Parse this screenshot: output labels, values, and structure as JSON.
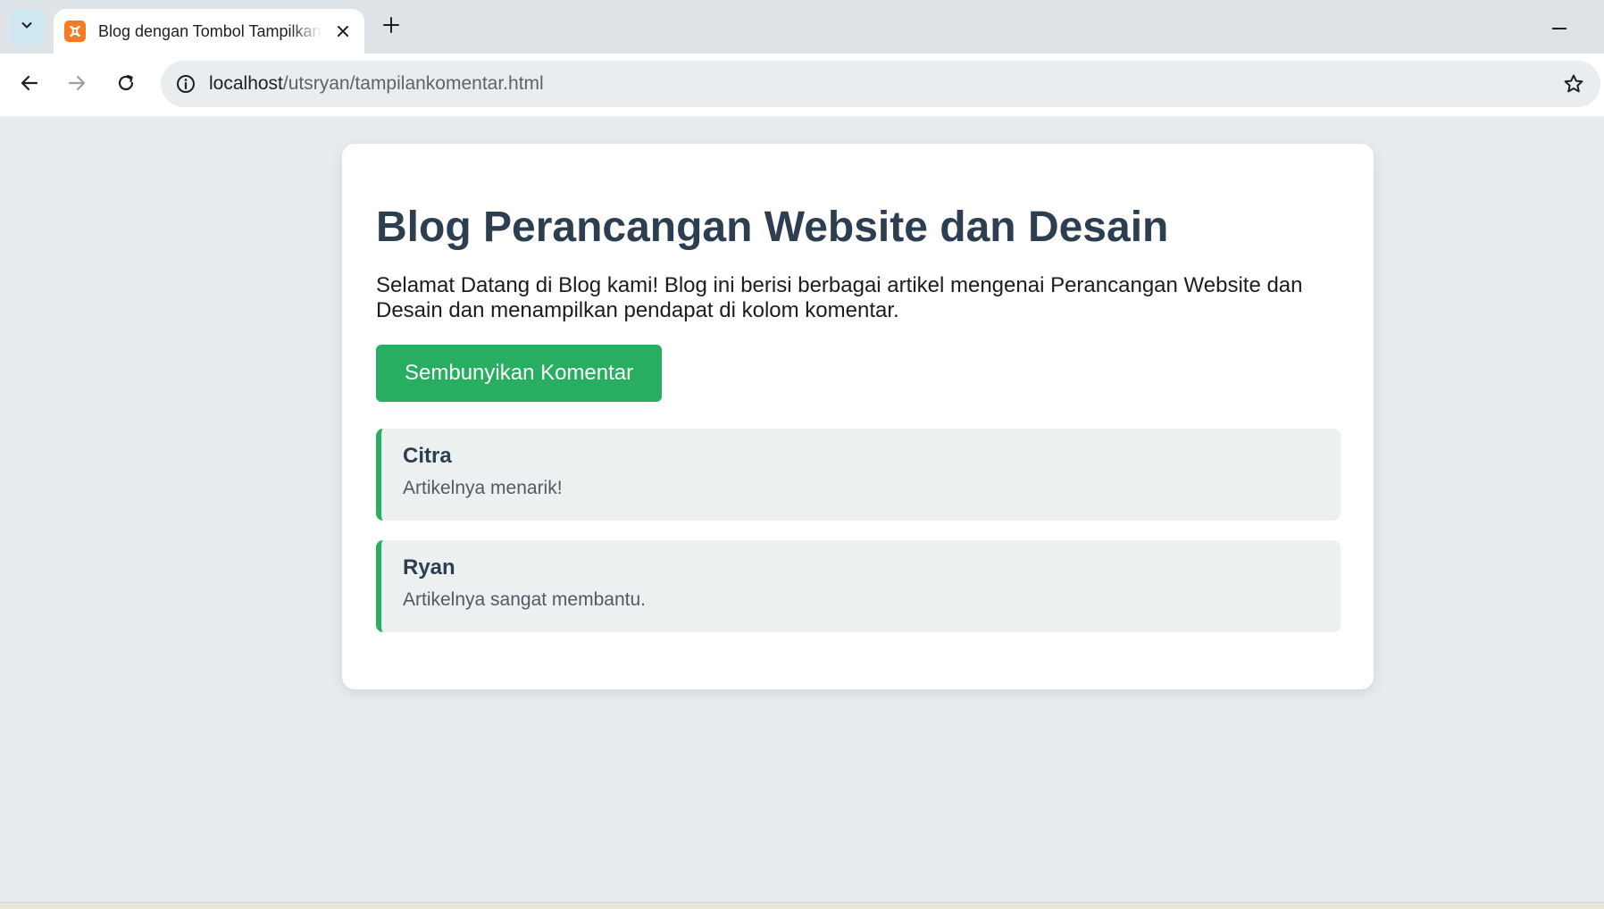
{
  "browser": {
    "tab_title": "Blog dengan Tombol Tampilkan Komentar",
    "url_host": "localhost",
    "url_path": "/utsryan/tampilankomentar.html"
  },
  "page": {
    "title": "Blog Perancangan Website dan Desain",
    "intro": "Selamat Datang di Blog kami! Blog ini berisi berbagai artikel mengenai Perancangan Website dan Desain dan menampilkan pendapat di kolom komentar.",
    "toggle_button_label": "Sembunyikan Komentar",
    "comments": [
      {
        "author": "Citra",
        "text": "Artikelnya menarik!"
      },
      {
        "author": "Ryan",
        "text": "Artikelnya sangat membantu."
      }
    ]
  },
  "colors": {
    "accent_green": "#27ae60",
    "heading": "#2c3e50",
    "comment_bg": "#ecf0f1",
    "page_bg": "#e8ecef"
  }
}
